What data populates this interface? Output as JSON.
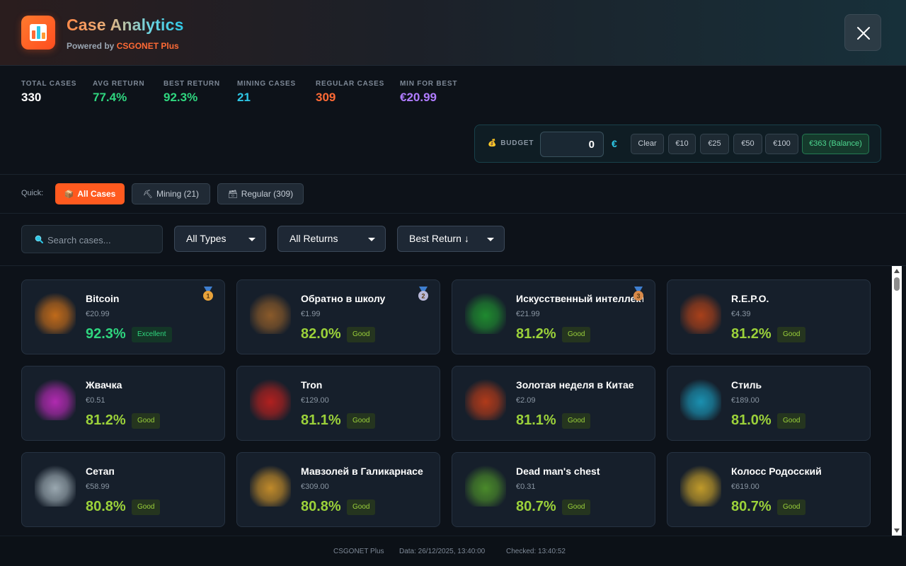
{
  "header": {
    "title": "Case Analytics",
    "subtitle_prefix": "Powered by",
    "subtitle_brand": "CSGONET Plus",
    "icons": {
      "logo": "bar-chart-icon",
      "close": "close-icon"
    }
  },
  "stats": [
    {
      "label": "TOTAL CASES",
      "value": "330",
      "color": "#ffffff"
    },
    {
      "label": "AVG RETURN",
      "value": "77.4%",
      "color": "#2fd67f"
    },
    {
      "label": "BEST RETURN",
      "value": "92.3%",
      "color": "#2fd67f"
    },
    {
      "label": "MINING CASES",
      "value": "21",
      "color": "#2ec7e6"
    },
    {
      "label": "REGULAR CASES",
      "value": "309",
      "color": "#ff6a35"
    },
    {
      "label": "MIN FOR BEST",
      "value": "€20.99",
      "color": "#b07cff"
    }
  ],
  "budget": {
    "label": "BUDGET",
    "icon": "money-bag-icon",
    "value": "0",
    "currency": "€",
    "buttons": [
      "Clear",
      "€10",
      "€25",
      "€50",
      "€100"
    ],
    "balance_button": "€363 (Balance)"
  },
  "quick": {
    "label": "Quick:",
    "buttons": [
      {
        "label": "All Cases",
        "icon": "package-icon",
        "glyph": "📦",
        "active": true
      },
      {
        "label": "Mining (21)",
        "icon": "pickaxe-icon",
        "glyph": "⛏",
        "active": false
      },
      {
        "label": "Regular (309)",
        "icon": "treasure-box-icon",
        "glyph": "🗃",
        "active": false
      }
    ]
  },
  "filters": {
    "search_placeholder": "Search cases...",
    "type_select": "All Types",
    "return_select": "All Returns",
    "sort_select": "Best Return ↓"
  },
  "cases": [
    {
      "name": "Bitcoin",
      "price": "€20.99",
      "return": "92.3%",
      "rating": "Excellent",
      "medal": "1",
      "thumb": "#c06a1a"
    },
    {
      "name": "Обратно в школу",
      "price": "€1.99",
      "return": "82.0%",
      "rating": "Good",
      "medal": "2",
      "thumb": "#8a5a2a"
    },
    {
      "name": "Искусственный интеллект",
      "price": "€21.99",
      "return": "81.2%",
      "rating": "Good",
      "medal": "3",
      "thumb": "#1f8a2f"
    },
    {
      "name": "R.E.P.O.",
      "price": "€4.39",
      "return": "81.2%",
      "rating": "Good",
      "medal": "",
      "thumb": "#a8401a"
    },
    {
      "name": "Жвачка",
      "price": "€0.51",
      "return": "81.2%",
      "rating": "Good",
      "medal": "",
      "thumb": "#b02ab0"
    },
    {
      "name": "Tron",
      "price": "€129.00",
      "return": "81.1%",
      "rating": "Good",
      "medal": "",
      "thumb": "#b0201f"
    },
    {
      "name": "Золотая неделя в Китае",
      "price": "€2.09",
      "return": "81.1%",
      "rating": "Good",
      "medal": "",
      "thumb": "#b03a1a"
    },
    {
      "name": "Стиль",
      "price": "€189.00",
      "return": "81.0%",
      "rating": "Good",
      "medal": "",
      "thumb": "#1a90b0"
    },
    {
      "name": "Сетап",
      "price": "€58.99",
      "return": "80.8%",
      "rating": "Good",
      "medal": "",
      "thumb": "#9aa8b0"
    },
    {
      "name": "Мавзолей в Галикарнасе",
      "price": "€309.00",
      "return": "80.8%",
      "rating": "Good",
      "medal": "",
      "thumb": "#c08a2a"
    },
    {
      "name": "Dead man's chest",
      "price": "€0.31",
      "return": "80.7%",
      "rating": "Good",
      "medal": "",
      "thumb": "#4a8a2a"
    },
    {
      "name": "Колосс Родосский",
      "price": "€619.00",
      "return": "80.7%",
      "rating": "Good",
      "medal": "",
      "thumb": "#c09a2a"
    }
  ],
  "footer": {
    "brand": "CSGONET Plus",
    "data": "Data: 26/12/2025, 13:40:00",
    "checked": "Checked: 13:40:52"
  }
}
